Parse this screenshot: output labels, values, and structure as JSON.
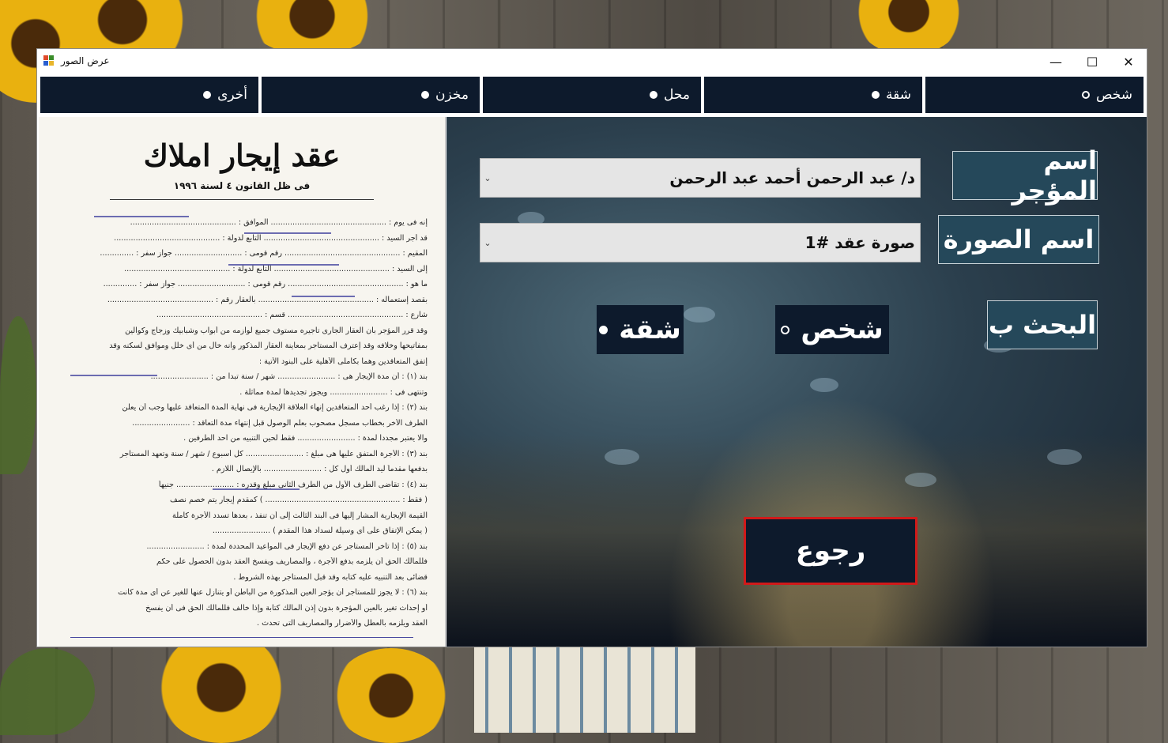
{
  "window": {
    "title": "عرض الصور"
  },
  "controls": {
    "minimize": "—",
    "maximize": "☐",
    "close": "✕"
  },
  "tabs": [
    {
      "label": "شخص",
      "selected": false
    },
    {
      "label": "شقة",
      "selected": true
    },
    {
      "label": "محل",
      "selected": true
    },
    {
      "label": "مخزن",
      "selected": true
    },
    {
      "label": "أخرى",
      "selected": true
    }
  ],
  "document": {
    "title": "عقد إيجار املاك",
    "subtitle": "فى ظل القانون ٤ لسنة ١٩٩٦",
    "lines": [
      "إنه فى يوم : ................................................ الموافق : ............................................",
      "قد أجر السيد : ................................................ التابع لدولة : ............................................",
      "المقيم : ................................................ رقم قومى : ............................ جواز سفر : ..............",
      "إلى السيد : ................................................ التابع لدولة : ............................................",
      "ما هو : ................................................ رقم قومى : ............................ جواز سفر : ..............",
      "بقصد إستعماله : ................................................ بالعقار رقم : ............................................",
      "شارع : ................................................ قسم : ............................................",
      "وقد قرر المؤجر بأن العقار الجارى تأجيره مستوف جميع لوازمه من أبواب وشبابيك وزجاج وكوالين",
      "بمفاتيحها وخلافه وقد إعترف المستأجر بمعاينة العقار المذكور وانه خال من أى خلل وموافق لسكنه وقد",
      "إتفق المتعاقدين وهما بكاملى الأهلية على البنود الأتية :",
      "بند (١) : أن مدة الإيجار هى : ........................ شهر / سنة تبدا من : ........................",
      "وتنتهى فى : ........................ ويجوز تجديدها لمدة مماثلة .",
      "بند (٢) : إذا رغب أحد المتعاقدين إنهاء العلاقة الإيجارية فى نهاية المدة المتعاقد عليها وجب أن يعلن",
      "الطرف الأخر بخطاب مسجل مصحوب بعلم الوصول قبل إنتهاء مدة التعاقد : ........................",
      "والا يعتبر مجددا لمدة : ........................ فقط لحين التنبيه من احد الطرفين .",
      "بند (٣) : الأجرة المتفق عليها هى مبلغ : ........................ كل أسبوع / شهر / سنة وتعهد المستأجر",
      "بدفعها مقدماً ليد المالك أول كل : ........................ بالإيصال اللازم .",
      "بند (٤) : تقاضى الطرف الأول من الطرف الثانى مبلغ وقدره : ........................ جنيهاً",
      "( فقط : ........................................................ ) كمقدم إيجار يتم خصم نصف",
      "القيمة الإيجارية المشار إليها فى البند الثالث إلى أن تنفذ ، بعدها تسدد الأجرة كاملة",
      "( يمكن الإتفاق على أى وسيلة لسداد هذا المقدم ) ........................",
      "بند (٥) : إذا تأخر المستأجر عن دفع الإيجار فى المواعيد المحددة لمدة : ........................",
      "فللمالك الحق أن يلزمه بدفع الأجرة ، والمصاريف ويفسخ العقد بدون الحصول على حكم",
      "قضائى بعد التنبيه عليه كتابه وقد قبل المستأجر بهذه الشروط .",
      "بند (٦) : لا يجوز للمستأجر أن يؤجر العين المذكورة من الباطن أو يتنازل عنها للغير عن أى مدة كانت",
      "أو إحداث تغير بالعين المؤجرة بدون إذن المالك كتابة وإذا خالف فللمالك الحق فى أن يفسخ",
      "العقد ويلزمه بالعطل والأضرار والمصاريف التى تحدث ."
    ]
  },
  "form": {
    "owner_label": "اسم المؤجر",
    "owner_value": "د/ عبد الرحمن أحمد عبد الرحمن",
    "image_label": "اسم الصورة",
    "image_value": "صورة عقد #1",
    "search_label": "البحث ب",
    "search_options": [
      {
        "label": "شخص",
        "selected": false
      },
      {
        "label": "شقة",
        "selected": true
      }
    ],
    "back_label": "رجوع"
  }
}
